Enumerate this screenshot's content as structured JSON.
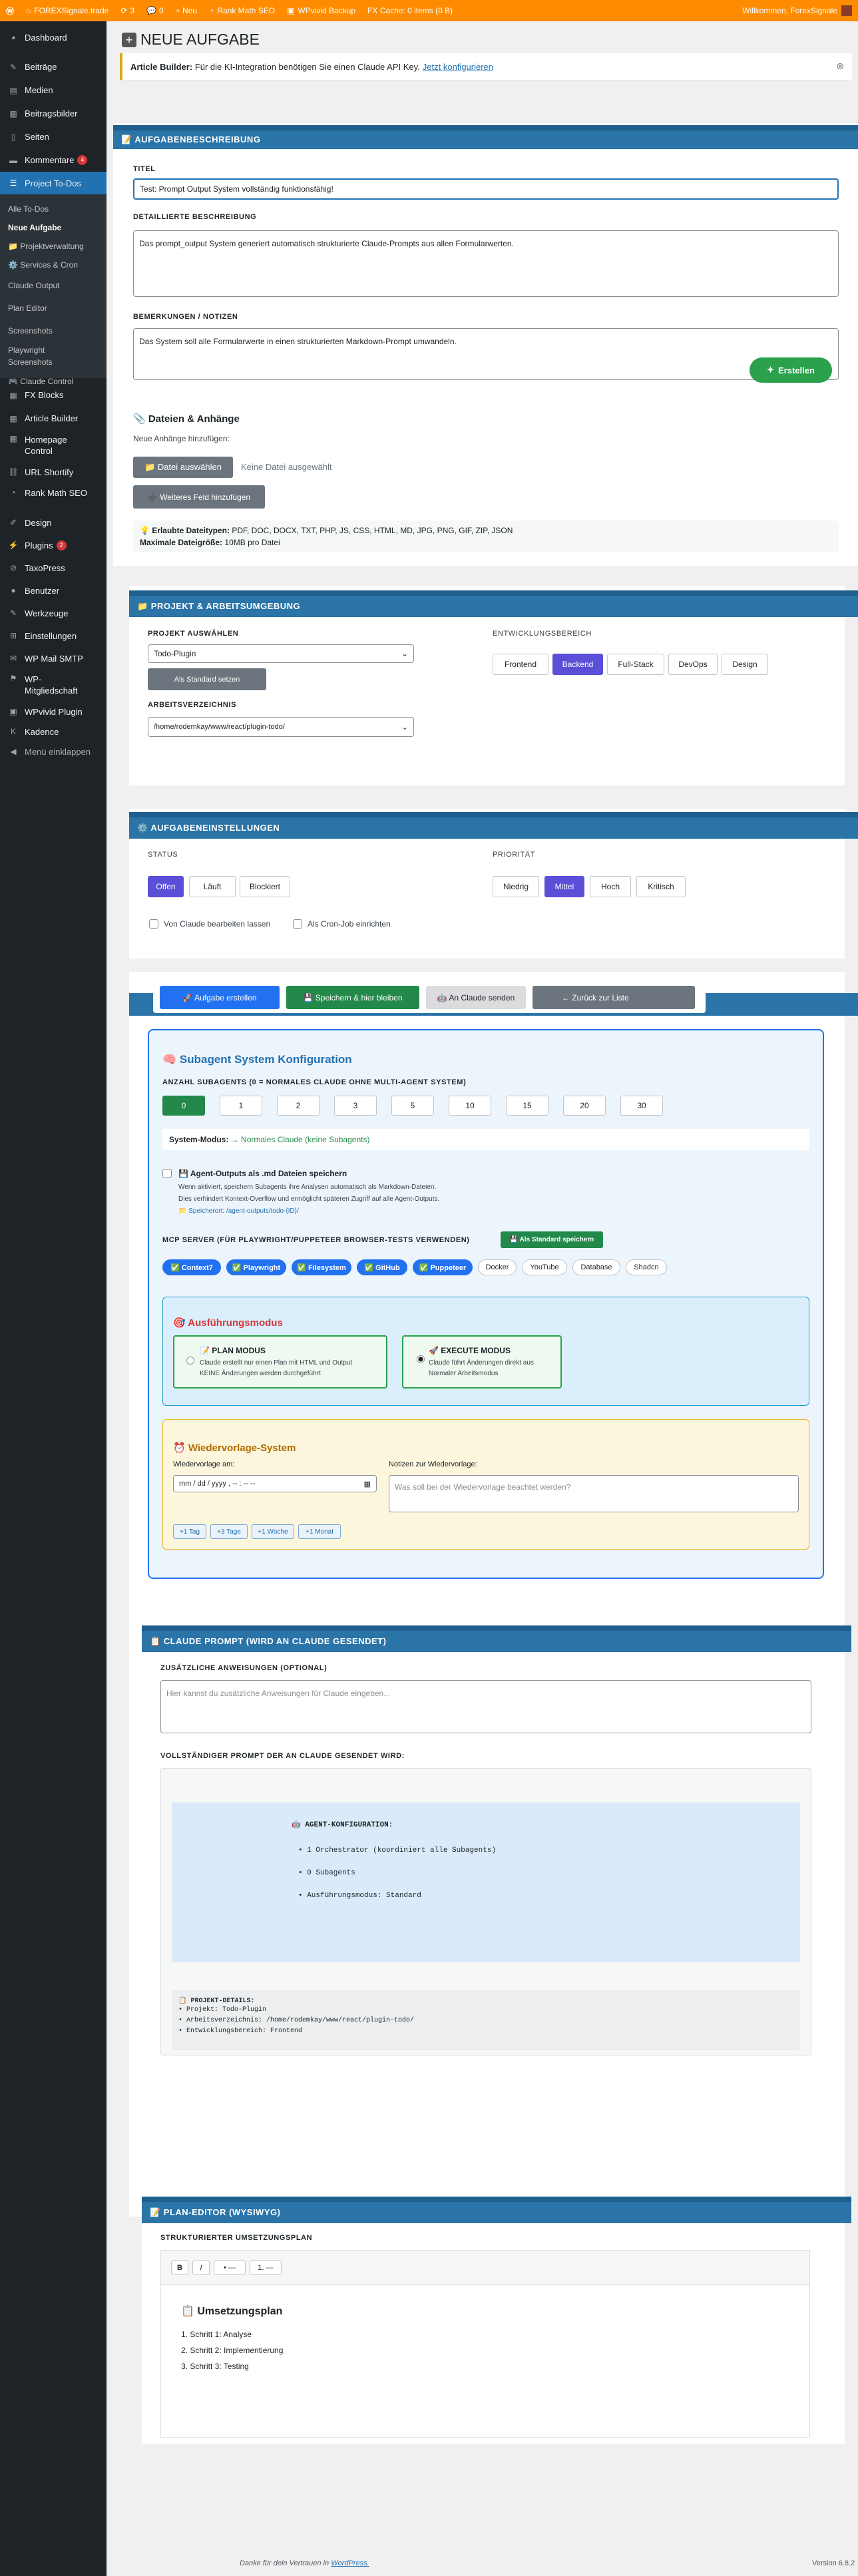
{
  "adminbar": {
    "wp_logo": "wordpress-icon",
    "site": "FOREXSignale.trade",
    "updates": "3",
    "comments": "0",
    "new": "+ Neu",
    "rankmath": "Rank Math SEO",
    "wpvivid": "WPvivid Backup",
    "cache": "FX Cache: 0 items (0 B)",
    "welcome": "Willkommen, ForexSignale"
  },
  "sidebar": {
    "items": [
      {
        "label": "Dashboard",
        "icon": "dashboard-icon"
      },
      {
        "label": "Beiträge",
        "icon": "pin-icon"
      },
      {
        "label": "Medien",
        "icon": "media-icon"
      },
      {
        "label": "Beitragsbilder",
        "icon": "image-icon"
      },
      {
        "label": "Seiten",
        "icon": "page-icon"
      },
      {
        "label": "Kommentare",
        "icon": "comment-icon",
        "badge": "4"
      },
      {
        "label": "Project To-Dos",
        "icon": "list-icon"
      }
    ],
    "submenu": [
      "Alle To-Dos",
      "Neue Aufgabe",
      "📁 Projektverwaltung",
      "⚙️ Services & Cron",
      "Claude Output",
      "Plan Editor",
      "Screenshots",
      "Playwright Screenshots",
      "🎮 Claude Control"
    ],
    "items2": [
      {
        "label": "FX Blocks",
        "icon": "block-icon"
      },
      {
        "label": "Article Builder",
        "icon": "block-icon"
      },
      {
        "label": "Homepage Control",
        "icon": "block-icon"
      },
      {
        "label": "URL Shortify",
        "icon": "link-icon"
      },
      {
        "label": "Rank Math SEO",
        "icon": "chart-icon"
      },
      {
        "label": "Design",
        "icon": "brush-icon"
      },
      {
        "label": "Plugins",
        "icon": "plugin-icon",
        "badge": "2"
      },
      {
        "label": "TaxoPress",
        "icon": "tag-icon"
      },
      {
        "label": "Benutzer",
        "icon": "user-icon"
      },
      {
        "label": "Werkzeuge",
        "icon": "wrench-icon"
      },
      {
        "label": "Einstellungen",
        "icon": "settings-icon"
      },
      {
        "label": "WP Mail SMTP",
        "icon": "mail-icon"
      },
      {
        "label": "WP-Mitgliedschaft",
        "icon": "members-icon"
      },
      {
        "label": "WPvivid Plugin",
        "icon": "backup-icon"
      },
      {
        "label": "Kadence",
        "icon": "kadence-icon"
      },
      {
        "label": "Menü einklappen",
        "icon": "collapse-icon"
      }
    ]
  },
  "page": {
    "title": "NEUE AUFGABE",
    "notice_bold": "Article Builder:",
    "notice_text": "Für die KI-Integration benötigen Sie einen Claude API Key.",
    "notice_link": "Jetzt konfigurieren"
  },
  "task": {
    "section": "📝 AUFGABENBESCHREIBUNG",
    "title_label": "TITEL",
    "title_value": "Test: Prompt Output System vollständig funktionsfähig!",
    "desc_label": "DETAILLIERTE BESCHREIBUNG",
    "desc_value": "Das prompt_output System generiert automatisch strukturierte Claude-Prompts aus allen Formularwerten.",
    "notes_label": "BEMERKUNGEN / NOTIZEN",
    "notes_value": "Das System soll alle Formularwerte in einen strukturierten Markdown-Prompt umwandeln.",
    "create_button": "Erstellen"
  },
  "files": {
    "title": "📎 Dateien & Anhänge",
    "sub": "Neue Anhänge hinzufügen:",
    "choose": "📁 Datei auswählen",
    "none": "Keine Datei ausgewählt",
    "add_field": "➕ Weiteres Feld hinzufügen",
    "allowed_label": "💡 Erlaubte Dateitypen:",
    "allowed": "PDF, DOC, DOCX, TXT, PHP, JS, CSS, HTML, MD, JPG, PNG, GIF, ZIP, JSON",
    "max_label": "Maximale Dateigröße:",
    "max": "10MB pro Datei"
  },
  "project": {
    "section": "📁 PROJEKT & ARBEITSUMGEBUNG",
    "select_label": "PROJEKT AUSWÄHLEN",
    "select_value": "Todo-Plugin",
    "default_button": "Als Standard setzen",
    "dir_label": "ARBEITSVERZEICHNIS",
    "dir_value": "/home/rodemkay/www/react/plugin-todo/",
    "area_label": "ENTWICKLUNGSBEREICH",
    "areas": [
      "Frontend",
      "Backend",
      "Full-Stack",
      "DevOps",
      "Design"
    ]
  },
  "settings": {
    "section": "⚙️ AUFGABENEINSTELLUNGEN",
    "status_label": "STATUS",
    "status": [
      "Offen",
      "Läuft",
      "Blockiert"
    ],
    "priority_label": "PRIORITÄT",
    "priority": [
      "Niedrig",
      "Mittel",
      "Hoch",
      "Kritisch"
    ],
    "cb_claude": "Von Claude bearbeiten lassen",
    "cb_cron": "Als Cron-Job einrichten"
  },
  "actions": {
    "create": "🚀 Aufgabe erstellen",
    "save_stay": "💾 Speichern & hier bleiben",
    "send_claude": "🤖 An Claude senden",
    "back": "← Zurück zur Liste"
  },
  "subagent": {
    "title": "🧠 Subagent System Konfiguration",
    "count_label": "ANZAHL SUBAGENTS (0 = NORMALES CLAUDE OHNE MULTI-AGENT SYSTEM)",
    "counts": [
      "0",
      "1",
      "2",
      "3",
      "5",
      "10",
      "15",
      "20",
      "30"
    ],
    "mode_label": "System-Modus:",
    "mode_value": "→ Normales Claude (keine Subagents)",
    "save_outputs": "💾 Agent-Outputs als .md Dateien speichern",
    "save_desc1": "Wenn aktiviert, speichern Subagents ihre Analysen automatisch als Markdown-Dateien.",
    "save_desc2": "Dies verhindert Kontext-Overflow und ermöglicht späteren Zugriff auf alle Agent-Outputs.",
    "save_path": "📁 Speicherort: /agent-outputs/todo-{ID}/",
    "mcp_label": "MCP SERVER (FÜR PLAYWRIGHT/PUPPETEER BROWSER-TESTS VERWENDEN)",
    "mcp_default": "💾 Als Standard speichern",
    "mcp": [
      {
        "label": "✅ Context7",
        "on": true
      },
      {
        "label": "✅ Playwright",
        "on": true
      },
      {
        "label": "✅ Filesystem",
        "on": true
      },
      {
        "label": "✅ GitHub",
        "on": true
      },
      {
        "label": "✅ Puppeteer",
        "on": true
      },
      {
        "label": "Docker",
        "on": false
      },
      {
        "label": "YouTube",
        "on": false
      },
      {
        "label": "Database",
        "on": false
      },
      {
        "label": "Shadcn",
        "on": false
      }
    ]
  },
  "exec": {
    "title": "🎯 Ausführungsmodus",
    "plan_title": "📝 PLAN MODUS",
    "plan_desc1": "Claude erstellt nur einen Plan mit HTML und Output",
    "plan_desc2": "KEINE Änderungen werden durchgeführt",
    "exec_title": "🚀 EXECUTE MODUS",
    "exec_desc1": "Claude führt Änderungen direkt aus",
    "exec_desc2": "Normaler Arbeitsmodus"
  },
  "reminder": {
    "title": "⏰ Wiedervorlage-System",
    "date_label": "Wiedervorlage am:",
    "date_value": "mm / dd / yyyy , -- : -- --",
    "notes_label": "Notizen zur Wiedervorlage:",
    "notes_placeholder": "Was soll bei der Wiedervorlage beachtet werden?",
    "quick": [
      "+1 Tag",
      "+3 Tage",
      "+1 Woche",
      "+1 Monat"
    ]
  },
  "prompt": {
    "section": "📋 CLAUDE PROMPT (WIRD AN CLAUDE GESENDET)",
    "extra_label": "ZUSÄTZLICHE ANWEISUNGEN (OPTIONAL)",
    "extra_placeholder": "Hier kannst du zusätzliche Anweisungen für Claude eingeben...",
    "full_label": "VOLLSTÄNDIGER PROMPT DER AN CLAUDE GESENDET WIRD:",
    "agent_head": "🤖 AGENT-KONFIGURATION:",
    "agent_lines": [
      "• 1 Orchestrator (koordiniert alle Subagents)",
      "• 0 Subagents",
      "• Ausführungsmodus: Standard"
    ],
    "proj_head": "📋 PROJEKT-DETAILS:",
    "proj_lines": [
      "• Projekt: Todo-Plugin",
      "• Arbeitsverzeichnis: /home/rodemkay/www/react/plugin-todo/",
      "• Entwicklungsbereich: Frontend"
    ]
  },
  "plan": {
    "section": "📝 PLAN-EDITOR (WYSIWYG)",
    "label": "STRUKTURIERTER UMSETZUNGSPLAN",
    "toolbar": [
      "B",
      "I",
      "• —",
      "1. —"
    ],
    "heading": "📋 Umsetzungsplan",
    "steps": [
      "Schritt 1: Analyse",
      "Schritt 2: Implementierung",
      "Schritt 3: Testing"
    ]
  },
  "footer": {
    "thanks": "Danke für dein Vertrauen in",
    "wp": "WordPress.",
    "version": "Version 6.8.2"
  }
}
